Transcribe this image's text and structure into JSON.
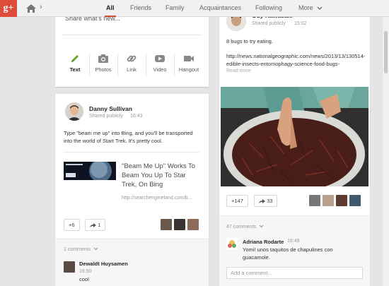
{
  "app": {
    "logo": "g+"
  },
  "nav": {
    "tabs": [
      {
        "label": "All",
        "active": true
      },
      {
        "label": "Friends"
      },
      {
        "label": "Family"
      },
      {
        "label": "Acquaintances"
      },
      {
        "label": "Following"
      },
      {
        "label": "More"
      }
    ]
  },
  "share": {
    "placeholder": "Share what's new...",
    "actions": [
      {
        "label": "Text",
        "icon": "pencil-icon"
      },
      {
        "label": "Photos",
        "icon": "camera-icon"
      },
      {
        "label": "Link",
        "icon": "link-icon"
      },
      {
        "label": "Video",
        "icon": "video-icon"
      },
      {
        "label": "Hangout",
        "icon": "hangout-icon"
      }
    ]
  },
  "post_danny": {
    "author": "Danny Sullivan",
    "visibility": "Shared publicly",
    "time": "16:43",
    "text": "Type \"beam me up\" into Bing, and you'll be transported into the world of Start Trek. It's pretty cool.",
    "link_title": "\"Beam Me Up\" Works To Beam You Up To Star Trek, On Bing",
    "link_url": "http://searchengineland.com/b...",
    "plus_count": "+6",
    "share_count": "1",
    "comments_label": "2 comments",
    "comment": {
      "author": "Dewaldt Huysamen",
      "time": "16:50",
      "text": "cool"
    }
  },
  "post_guy": {
    "author": "Guy Kawasaki",
    "visibility": "Shared publicly",
    "time": "15:02",
    "text": "8 bugs to try eating.",
    "link_url": "http://news.nationalgeographic.com/news/2013/13/130514-edible-insects-entomophagy-science-food-bugs-",
    "read_more": "Read more",
    "plus_count": "+147",
    "share_count": "33",
    "comments_label": "47 comments",
    "comment": {
      "author": "Adriana Rodarte",
      "time": "16:49",
      "text": "Yomi! unos taquitos de chapulines con guacamole."
    },
    "add_comment_placeholder": "Add a comment..."
  }
}
